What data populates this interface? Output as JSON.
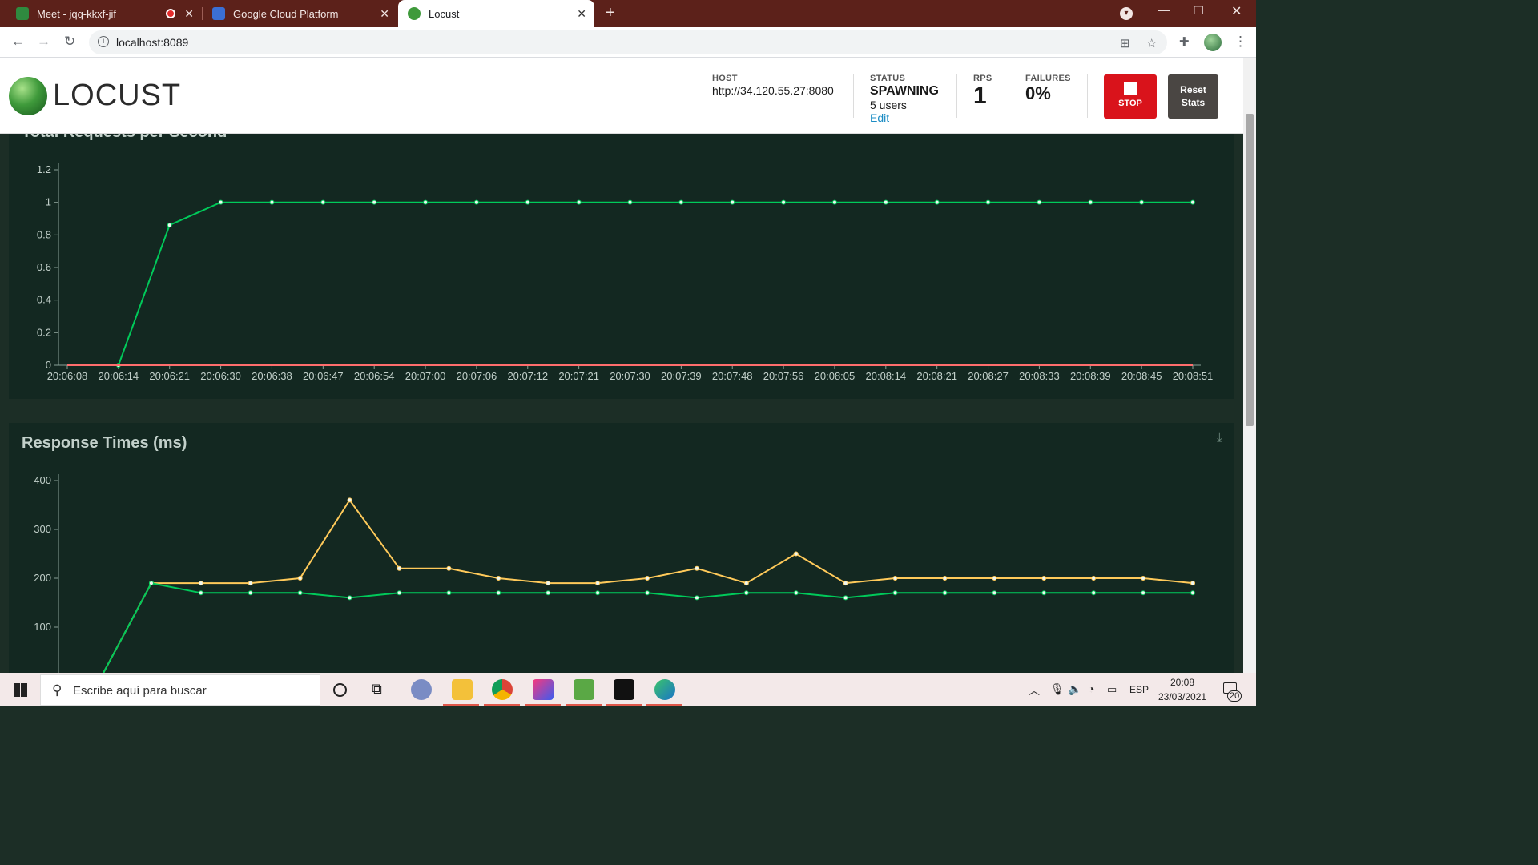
{
  "tabs": [
    {
      "title": "Meet - jqq-kkxf-jif",
      "close": "✕"
    },
    {
      "title": "Google Cloud Platform",
      "close": "✕"
    },
    {
      "title": "Locust",
      "close": "✕"
    }
  ],
  "new_tab": "+",
  "address": {
    "url": "localhost:8089"
  },
  "locust": {
    "logo": "LOCUST",
    "host_label": "HOST",
    "host_value": "http://34.120.55.27:8080",
    "status_label": "STATUS",
    "status_value": "SPAWNING",
    "users": "5 users",
    "edit": "Edit",
    "rps_label": "RPS",
    "rps_value": "1",
    "failures_label": "FAILURES",
    "failures_value": "0%",
    "stop_label": "STOP",
    "reset_label_1": "Reset",
    "reset_label_2": "Stats"
  },
  "chart_data": [
    {
      "type": "line",
      "title": "Total Requests per Second",
      "ylim": [
        0,
        1.2
      ],
      "yticks": [
        "0",
        "0.2",
        "0.4",
        "0.6",
        "0.8",
        "1",
        "1.2"
      ],
      "x": [
        "20:06:08",
        "20:06:14",
        "20:06:21",
        "20:06:30",
        "20:06:38",
        "20:06:47",
        "20:06:54",
        "20:07:00",
        "20:07:06",
        "20:07:12",
        "20:07:21",
        "20:07:30",
        "20:07:39",
        "20:07:48",
        "20:07:56",
        "20:08:05",
        "20:08:14",
        "20:08:21",
        "20:08:27",
        "20:08:33",
        "20:08:39",
        "20:08:45",
        "20:08:51"
      ],
      "series": [
        {
          "color": "#00ca5a",
          "values": [
            0,
            0,
            0.86,
            1,
            1,
            1,
            1,
            1,
            1,
            1,
            1,
            1,
            1,
            1,
            1,
            1,
            1,
            1,
            1,
            1,
            1,
            1,
            1
          ]
        },
        {
          "color": "#ff6d6d",
          "values": [
            0,
            0,
            0,
            0,
            0,
            0,
            0,
            0,
            0,
            0,
            0,
            0,
            0,
            0,
            0,
            0,
            0,
            0,
            0,
            0,
            0,
            0,
            0
          ]
        }
      ]
    },
    {
      "type": "line",
      "title": "Response Times (ms)",
      "yticks": [
        "100",
        "200",
        "300",
        "400"
      ],
      "series": [
        {
          "color": "#ffca5a",
          "values": [
            0,
            190,
            190,
            190,
            200,
            360,
            220,
            220,
            200,
            190,
            190,
            200,
            220,
            190,
            250,
            190,
            200,
            200,
            200,
            200,
            200,
            200,
            190
          ]
        },
        {
          "color": "#00ca5a",
          "values": [
            0,
            190,
            170,
            170,
            170,
            160,
            170,
            170,
            170,
            170,
            170,
            170,
            160,
            170,
            170,
            160,
            170,
            170,
            170,
            170,
            170,
            170,
            170
          ]
        }
      ]
    }
  ],
  "taskbar": {
    "search_placeholder": "Escribe aquí para buscar",
    "lang": "ESP",
    "time": "20:08",
    "date": "23/03/2021",
    "notifications": "20"
  }
}
